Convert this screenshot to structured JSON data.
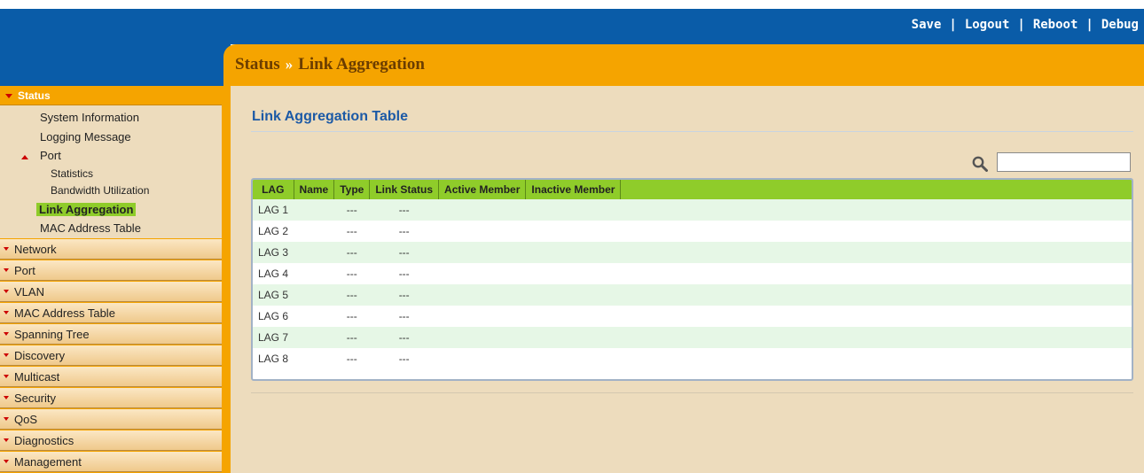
{
  "header": {
    "links": [
      "Save",
      "Logout",
      "Reboot",
      "Debug"
    ],
    "separator": "|"
  },
  "breadcrumb": {
    "parent": "Status",
    "separator": "»",
    "current": "Link Aggregation"
  },
  "sidebar": {
    "status_label": "Status",
    "status_items": {
      "system_info": "System Information",
      "logging": "Logging Message",
      "port": "Port",
      "statistics": "Statistics",
      "bandwidth": "Bandwidth Utilization",
      "link_aggregation": "Link Aggregation",
      "mac_table": "MAC Address Table"
    },
    "menus": [
      "Network",
      "Port",
      "VLAN",
      "MAC Address Table",
      "Spanning Tree",
      "Discovery",
      "Multicast",
      "Security",
      "QoS",
      "Diagnostics",
      "Management"
    ]
  },
  "main": {
    "section_title": "Link Aggregation Table",
    "search_placeholder": "",
    "columns": [
      "LAG",
      "Name",
      "Type",
      "Link Status",
      "Active Member",
      "Inactive Member"
    ],
    "rows": [
      {
        "lag": "LAG 1",
        "name": "",
        "type": "---",
        "link_status": "---",
        "active": "",
        "inactive": ""
      },
      {
        "lag": "LAG 2",
        "name": "",
        "type": "---",
        "link_status": "---",
        "active": "",
        "inactive": ""
      },
      {
        "lag": "LAG 3",
        "name": "",
        "type": "---",
        "link_status": "---",
        "active": "",
        "inactive": ""
      },
      {
        "lag": "LAG 4",
        "name": "",
        "type": "---",
        "link_status": "---",
        "active": "",
        "inactive": ""
      },
      {
        "lag": "LAG 5",
        "name": "",
        "type": "---",
        "link_status": "---",
        "active": "",
        "inactive": ""
      },
      {
        "lag": "LAG 6",
        "name": "",
        "type": "---",
        "link_status": "---",
        "active": "",
        "inactive": ""
      },
      {
        "lag": "LAG 7",
        "name": "",
        "type": "---",
        "link_status": "---",
        "active": "",
        "inactive": ""
      },
      {
        "lag": "LAG 8",
        "name": "",
        "type": "---",
        "link_status": "---",
        "active": "",
        "inactive": ""
      }
    ]
  },
  "colors": {
    "header_blue": "#0a5ca8",
    "accent_orange": "#f5a400",
    "content_bg": "#eddcbd",
    "table_header_green": "#8fcc2a",
    "title_blue": "#1c5aa6"
  },
  "icons": [
    "search-icon",
    "caret-down-icon",
    "caret-up-icon"
  ]
}
